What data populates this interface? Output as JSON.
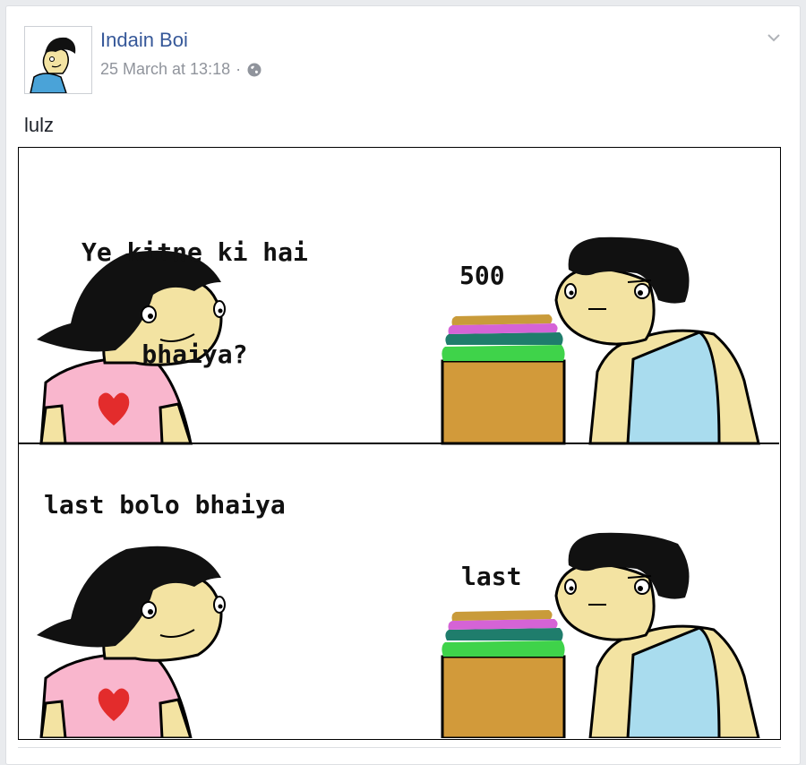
{
  "post": {
    "author": "Indain Boi",
    "timestamp": "25 March at 13:18",
    "separator": "·",
    "privacy_icon": "globe-icon",
    "menu_icon": "chevron-down-icon",
    "text": "lulz"
  },
  "comic": {
    "panel1": {
      "speech_girl_line1": "Ye kitne ki hai",
      "speech_girl_line2": "bhaiya?",
      "speech_boy": "500"
    },
    "panel2": {
      "speech_girl": "last bolo bhaiya",
      "speech_boy": "last"
    }
  },
  "colors": {
    "author_link": "#365899",
    "meta_text": "#90949c",
    "shirt_pink": "#f9b6cd",
    "heart_red": "#e32c2c",
    "skin": "#f3e3a2",
    "vest_blue": "#a9dcee",
    "box_brown": "#d29a3a"
  }
}
